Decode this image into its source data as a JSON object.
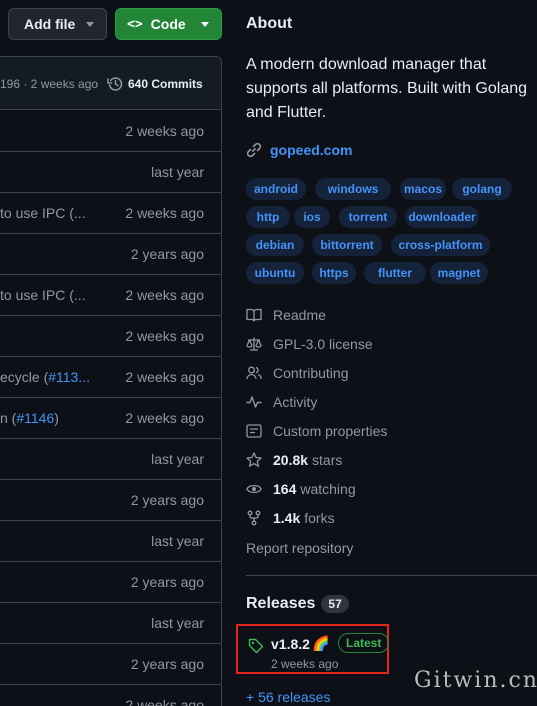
{
  "toolbar": {
    "add_file_label": "Add file",
    "code_label": "Code",
    "code_glyph": "<>"
  },
  "commit_header": {
    "hash_time": "196 · 2 weeks ago",
    "commits": "640 Commits"
  },
  "file_rows": [
    {
      "msg": "",
      "link": "",
      "date": "2 weeks ago"
    },
    {
      "msg": "",
      "link": "",
      "date": "last year"
    },
    {
      "msg": "to use IPC (...",
      "link": "",
      "date": "2 weeks ago"
    },
    {
      "msg": "",
      "link": "",
      "date": "2 years ago"
    },
    {
      "msg": "to use IPC (...",
      "link": "",
      "date": "2 weeks ago"
    },
    {
      "msg": "",
      "link": "",
      "date": "2 weeks ago"
    },
    {
      "msg": "ecycle (",
      "link": "#113...",
      "date": "2 weeks ago"
    },
    {
      "msg": "n (",
      "link": "#1146",
      "msg_end": ")",
      "date": "2 weeks ago"
    },
    {
      "msg": "",
      "link": "",
      "date": "last year"
    },
    {
      "msg": "",
      "link": "",
      "date": "2 years ago"
    },
    {
      "msg": "",
      "link": "",
      "date": "last year"
    },
    {
      "msg": "",
      "link": "",
      "date": "2 years ago"
    },
    {
      "msg": "",
      "link": "",
      "date": "last year"
    },
    {
      "msg": "",
      "link": "",
      "date": "2 years ago"
    },
    {
      "msg": "",
      "link": "",
      "date": "2 weeks ago"
    }
  ],
  "about": {
    "title": "About",
    "description": "A modern download manager that supports all platforms. Built with Golang and Flutter.",
    "homepage": "gopeed.com",
    "topics": [
      "android",
      "windows",
      "macos",
      "golang",
      "http",
      "ios",
      "torrent",
      "downloader",
      "debian",
      "bittorrent",
      "cross-platform",
      "ubuntu",
      "https",
      "flutter",
      "magnet"
    ]
  },
  "meta": {
    "readme": "Readme",
    "license": "GPL-3.0 license",
    "contributing": "Contributing",
    "activity": "Activity",
    "custom_properties": "Custom properties",
    "stars_count": "20.8k",
    "stars_label": "stars",
    "watching_count": "164",
    "watching_label": "watching",
    "forks_count": "1.4k",
    "forks_label": "forks",
    "report": "Report repository"
  },
  "releases": {
    "title": "Releases",
    "count": "57",
    "latest_name": "v1.8.2",
    "latest_emoji": "🌈",
    "latest_badge": "Latest",
    "latest_date": "2 weeks ago",
    "more": "+ 56 releases"
  },
  "watermark": "Gitwin.cn",
  "colors": {
    "background": "#0d1117",
    "accent": "#4493f8",
    "code_button": "#238636",
    "highlight_box": "#e5261f"
  }
}
